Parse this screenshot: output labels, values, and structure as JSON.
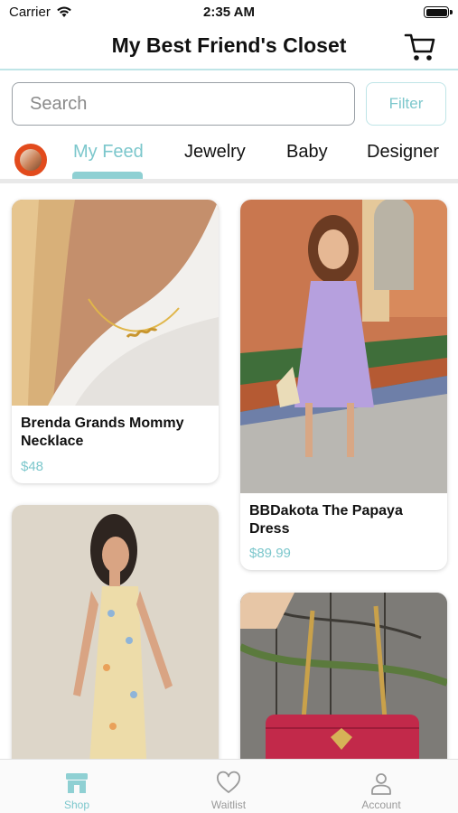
{
  "status_bar": {
    "carrier": "Carrier",
    "time": "2:35 AM"
  },
  "header": {
    "title": "My Best Friend's Closet"
  },
  "search": {
    "placeholder": "Search",
    "value": "",
    "filter_label": "Filter"
  },
  "tabs": [
    {
      "label": "My Feed",
      "active": true
    },
    {
      "label": "Jewelry",
      "active": false
    },
    {
      "label": "Baby",
      "active": false
    },
    {
      "label": "Designer",
      "active": false
    }
  ],
  "products": [
    {
      "title": "Brenda Grands Mommy Necklace",
      "price": "$48",
      "image": "gold-name-necklace-photo"
    },
    {
      "title": "BBDakota The Papaya Dress",
      "price": "$89.99",
      "image": "lavender-dress-photo"
    },
    {
      "title": "",
      "price": "",
      "image": "floral-slip-dress-photo"
    },
    {
      "title": "",
      "price": "",
      "image": "red-quilted-handbag-photo"
    }
  ],
  "tabbar": [
    {
      "label": "Shop",
      "icon": "shop-icon",
      "active": true
    },
    {
      "label": "Waitlist",
      "icon": "heart-icon",
      "active": false
    },
    {
      "label": "Account",
      "icon": "person-icon",
      "active": false
    }
  ],
  "colors": {
    "accent": "#7cc7cc",
    "accent_light": "#bfe5e7",
    "text": "#111111",
    "muted": "#9a9a9a"
  }
}
